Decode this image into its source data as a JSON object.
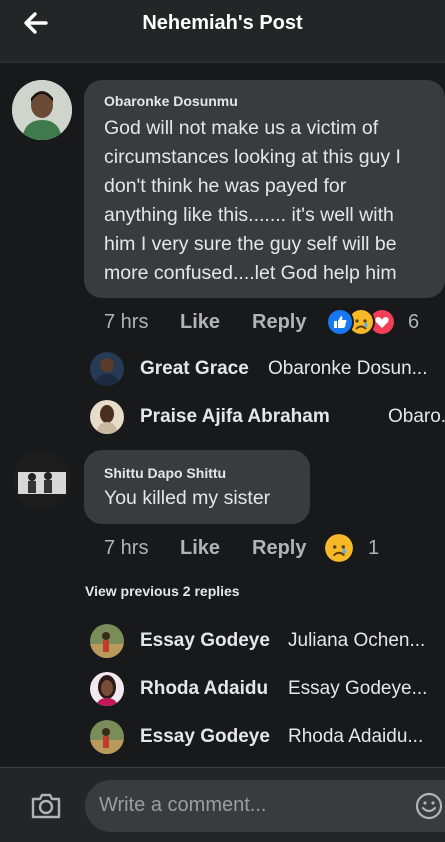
{
  "header": {
    "title": "Nehemiah's Post"
  },
  "comments": [
    {
      "name": "Obaronke Dosunmu",
      "lines": [
        "God will not make us a victim of",
        "circumstances looking at this guy I",
        "don't think he was payed for",
        "anything like this....... it's well with",
        "him I very sure the guy self will be",
        "more confused....let God help him"
      ],
      "time": "7 hrs",
      "like": "Like",
      "reply": "Reply",
      "reaction_count": "6",
      "reactions": [
        "like-icon",
        "sad-icon",
        "love-icon"
      ],
      "replies": [
        {
          "name": "Great Grace",
          "text": "Obaronke Dosun..."
        },
        {
          "name": "Praise Ajifa Abraham",
          "text": "Obaro..."
        }
      ]
    },
    {
      "name": "Shittu Dapo Shittu",
      "text": "You killed my sister",
      "time": "7 hrs",
      "like": "Like",
      "reply": "Reply",
      "reaction_count": "1",
      "reactions": [
        "sad-icon"
      ],
      "view_previous": "View previous 2 replies",
      "replies": [
        {
          "name": "Essay Godeye",
          "text": "Juliana Ochen..."
        },
        {
          "name": "Rhoda Adaidu",
          "text": "Essay Godeye..."
        },
        {
          "name": "Essay Godeye",
          "text": "Rhoda Adaidu..."
        }
      ]
    }
  ],
  "composer": {
    "placeholder": "Write a comment..."
  },
  "colors": {
    "background": "#18191a",
    "bubble": "#3a3b3c",
    "like_blue": "#1877f2",
    "love_red": "#f33e58",
    "sad_yellow": "#f7b928"
  }
}
